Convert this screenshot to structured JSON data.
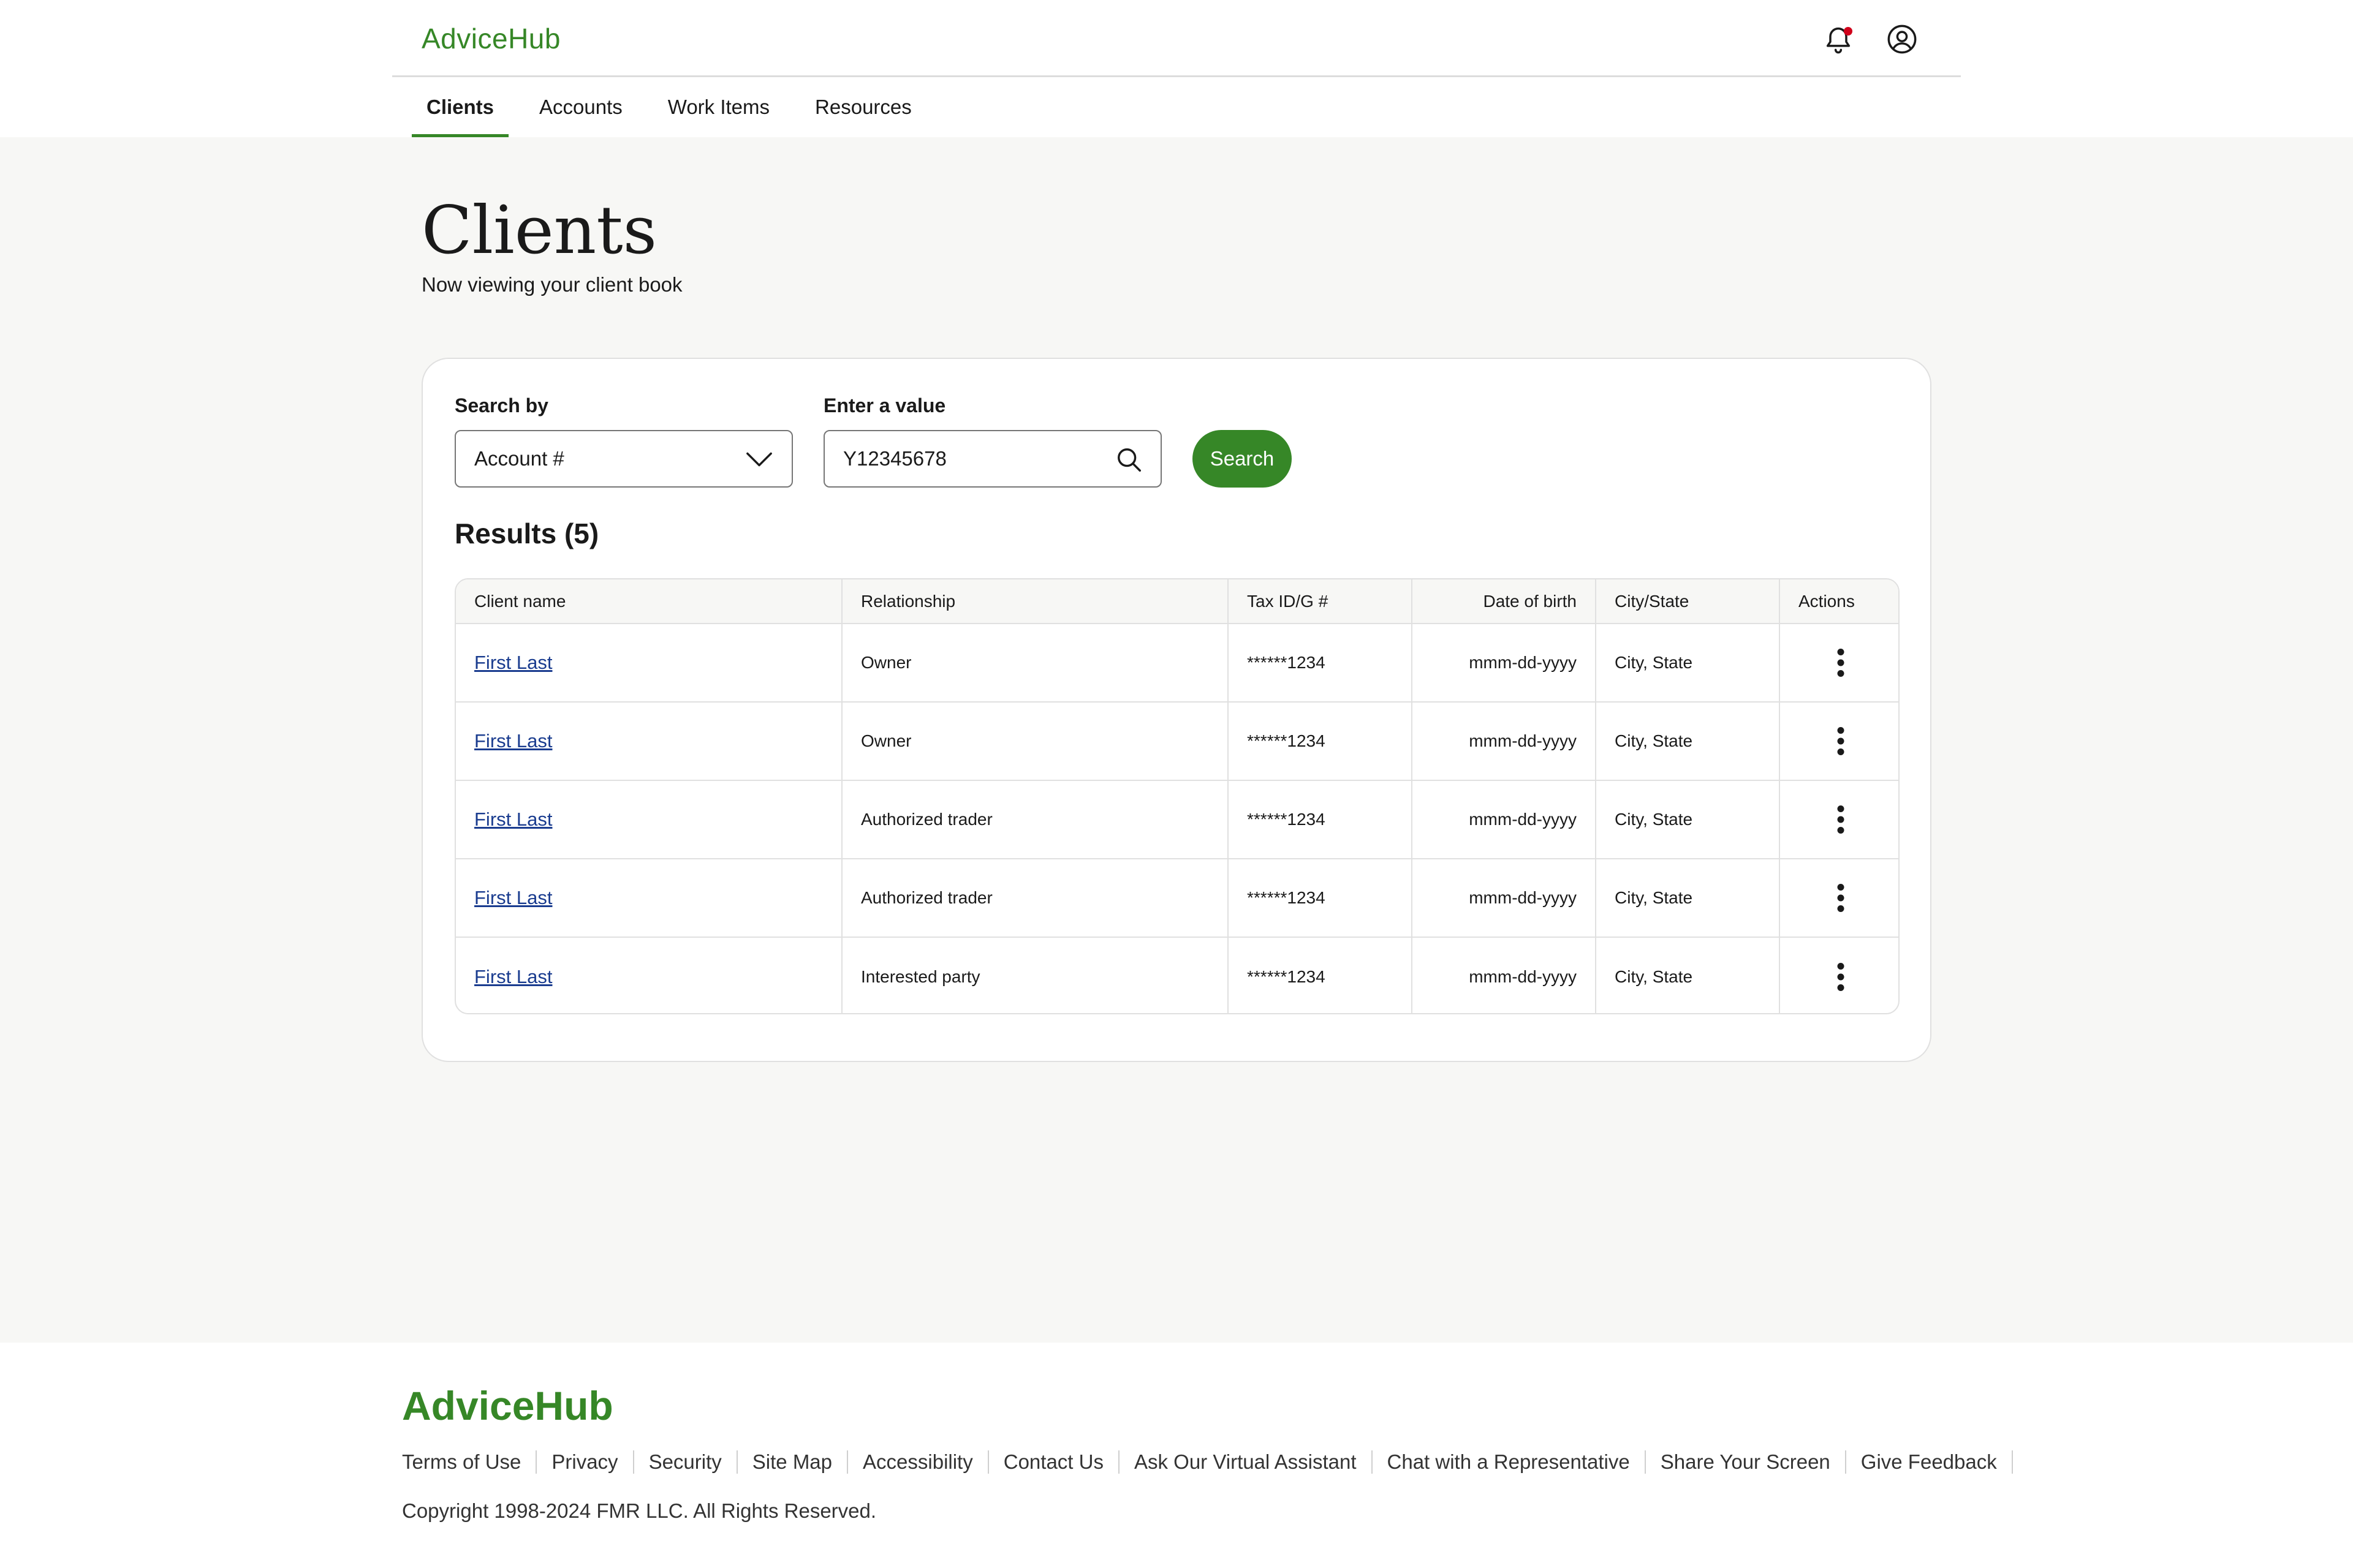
{
  "header": {
    "logo": "AdviceHub",
    "tabs": [
      {
        "label": "Clients",
        "active": true
      },
      {
        "label": "Accounts",
        "active": false
      },
      {
        "label": "Work Items",
        "active": false
      },
      {
        "label": "Resources",
        "active": false
      }
    ]
  },
  "page": {
    "title": "Clients",
    "subtitle": "Now viewing your client book"
  },
  "search": {
    "search_by_label": "Search by",
    "search_by_value": "Account #",
    "value_label": "Enter a value",
    "value": "Y12345678",
    "button_label": "Search"
  },
  "results": {
    "title": "Results (5)",
    "columns": [
      "Client name",
      "Relationship",
      "Tax ID/G #",
      "Date of birth",
      "City/State",
      "Actions"
    ],
    "rows": [
      {
        "name": "First Last",
        "relationship": "Owner",
        "tax_id": "******1234",
        "dob": "mmm-dd-yyyy",
        "city_state": "City, State"
      },
      {
        "name": "First Last",
        "relationship": "Owner",
        "tax_id": "******1234",
        "dob": "mmm-dd-yyyy",
        "city_state": "City, State"
      },
      {
        "name": "First Last",
        "relationship": "Authorized trader",
        "tax_id": "******1234",
        "dob": "mmm-dd-yyyy",
        "city_state": "City, State"
      },
      {
        "name": "First Last",
        "relationship": "Authorized trader",
        "tax_id": "******1234",
        "dob": "mmm-dd-yyyy",
        "city_state": "City, State"
      },
      {
        "name": "First Last",
        "relationship": "Interested party",
        "tax_id": "******1234",
        "dob": "mmm-dd-yyyy",
        "city_state": "City, State"
      }
    ]
  },
  "footer": {
    "logo": "AdviceHub",
    "links": [
      "Terms of Use",
      "Privacy",
      "Security",
      "Site Map",
      "Accessibility",
      "Contact Us",
      "Ask Our Virtual Assistant",
      "Chat with a Representative",
      "Share Your Screen",
      "Give Feedback"
    ],
    "copyright": "Copyright 1998-2024 FMR LLC. All Rights Reserved."
  },
  "icons": {
    "notifications": "bell-icon",
    "profile": "user-circle-icon",
    "dropdown": "chevron-down-icon",
    "search": "search-icon",
    "row_actions": "more-vertical-icon"
  },
  "colors": {
    "brand": "#368727",
    "link": "#1a3c8f",
    "notification_dot": "#d0021b",
    "page_background": "#f7f7f5"
  }
}
